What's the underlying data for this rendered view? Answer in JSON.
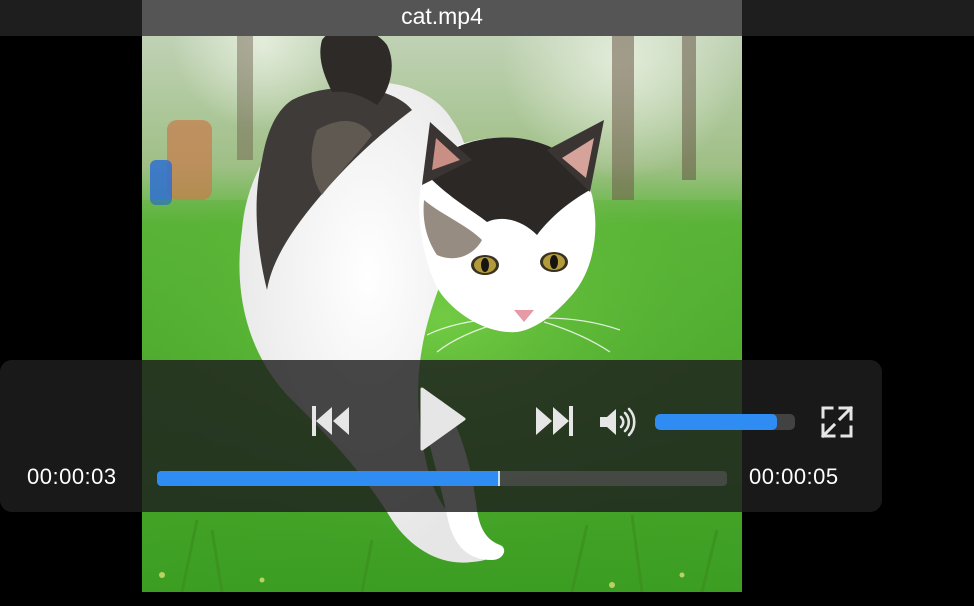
{
  "window": {
    "title": "cat.mp4"
  },
  "video": {
    "subject": "cat-walking-on-grass"
  },
  "player": {
    "elapsed_time": "00:00:03",
    "total_time": "00:00:05",
    "progress_fraction": 0.6,
    "volume_fraction": 0.87,
    "state": "paused",
    "accent_color": "#2f8cf2",
    "icons": {
      "previous": "skip-back-icon",
      "play": "play-icon",
      "next": "skip-forward-icon",
      "volume": "speaker-volume-icon",
      "fullscreen": "fullscreen-icon"
    }
  }
}
